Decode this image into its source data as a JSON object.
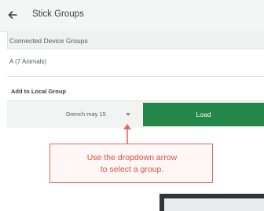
{
  "header": {
    "title": "Stick Groups",
    "back_icon": "arrow-left-icon"
  },
  "connected_groups": {
    "heading": "Connected Device Groups",
    "items": [
      {
        "label": "A (7 Animals)"
      }
    ]
  },
  "local_group": {
    "section_label": "Add to Local Group",
    "dropdown_value": "Drench may 15",
    "load_label": "Load"
  },
  "annotation": {
    "line1": "Use the dropdown arrow",
    "line2": "to select a group."
  },
  "colors": {
    "load_button": "#23874a",
    "annotation": "#e04e41",
    "header_bg": "#f4f5f5"
  }
}
